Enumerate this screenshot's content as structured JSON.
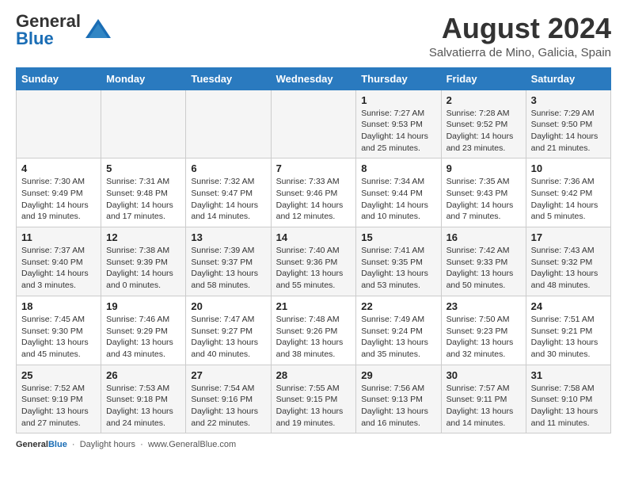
{
  "header": {
    "logo_line1": "General",
    "logo_line2": "Blue",
    "main_title": "August 2024",
    "subtitle": "Salvatierra de Mino, Galicia, Spain"
  },
  "footer": {
    "daylight_label": "Daylight hours",
    "footer_url": "www.GeneralBlue.com"
  },
  "days_of_week": [
    "Sunday",
    "Monday",
    "Tuesday",
    "Wednesday",
    "Thursday",
    "Friday",
    "Saturday"
  ],
  "weeks": [
    [
      {
        "day": "",
        "detail": ""
      },
      {
        "day": "",
        "detail": ""
      },
      {
        "day": "",
        "detail": ""
      },
      {
        "day": "",
        "detail": ""
      },
      {
        "day": "1",
        "detail": "Sunrise: 7:27 AM\nSunset: 9:53 PM\nDaylight: 14 hours and 25 minutes."
      },
      {
        "day": "2",
        "detail": "Sunrise: 7:28 AM\nSunset: 9:52 PM\nDaylight: 14 hours and 23 minutes."
      },
      {
        "day": "3",
        "detail": "Sunrise: 7:29 AM\nSunset: 9:50 PM\nDaylight: 14 hours and 21 minutes."
      }
    ],
    [
      {
        "day": "4",
        "detail": "Sunrise: 7:30 AM\nSunset: 9:49 PM\nDaylight: 14 hours and 19 minutes."
      },
      {
        "day": "5",
        "detail": "Sunrise: 7:31 AM\nSunset: 9:48 PM\nDaylight: 14 hours and 17 minutes."
      },
      {
        "day": "6",
        "detail": "Sunrise: 7:32 AM\nSunset: 9:47 PM\nDaylight: 14 hours and 14 minutes."
      },
      {
        "day": "7",
        "detail": "Sunrise: 7:33 AM\nSunset: 9:46 PM\nDaylight: 14 hours and 12 minutes."
      },
      {
        "day": "8",
        "detail": "Sunrise: 7:34 AM\nSunset: 9:44 PM\nDaylight: 14 hours and 10 minutes."
      },
      {
        "day": "9",
        "detail": "Sunrise: 7:35 AM\nSunset: 9:43 PM\nDaylight: 14 hours and 7 minutes."
      },
      {
        "day": "10",
        "detail": "Sunrise: 7:36 AM\nSunset: 9:42 PM\nDaylight: 14 hours and 5 minutes."
      }
    ],
    [
      {
        "day": "11",
        "detail": "Sunrise: 7:37 AM\nSunset: 9:40 PM\nDaylight: 14 hours and 3 minutes."
      },
      {
        "day": "12",
        "detail": "Sunrise: 7:38 AM\nSunset: 9:39 PM\nDaylight: 14 hours and 0 minutes."
      },
      {
        "day": "13",
        "detail": "Sunrise: 7:39 AM\nSunset: 9:37 PM\nDaylight: 13 hours and 58 minutes."
      },
      {
        "day": "14",
        "detail": "Sunrise: 7:40 AM\nSunset: 9:36 PM\nDaylight: 13 hours and 55 minutes."
      },
      {
        "day": "15",
        "detail": "Sunrise: 7:41 AM\nSunset: 9:35 PM\nDaylight: 13 hours and 53 minutes."
      },
      {
        "day": "16",
        "detail": "Sunrise: 7:42 AM\nSunset: 9:33 PM\nDaylight: 13 hours and 50 minutes."
      },
      {
        "day": "17",
        "detail": "Sunrise: 7:43 AM\nSunset: 9:32 PM\nDaylight: 13 hours and 48 minutes."
      }
    ],
    [
      {
        "day": "18",
        "detail": "Sunrise: 7:45 AM\nSunset: 9:30 PM\nDaylight: 13 hours and 45 minutes."
      },
      {
        "day": "19",
        "detail": "Sunrise: 7:46 AM\nSunset: 9:29 PM\nDaylight: 13 hours and 43 minutes."
      },
      {
        "day": "20",
        "detail": "Sunrise: 7:47 AM\nSunset: 9:27 PM\nDaylight: 13 hours and 40 minutes."
      },
      {
        "day": "21",
        "detail": "Sunrise: 7:48 AM\nSunset: 9:26 PM\nDaylight: 13 hours and 38 minutes."
      },
      {
        "day": "22",
        "detail": "Sunrise: 7:49 AM\nSunset: 9:24 PM\nDaylight: 13 hours and 35 minutes."
      },
      {
        "day": "23",
        "detail": "Sunrise: 7:50 AM\nSunset: 9:23 PM\nDaylight: 13 hours and 32 minutes."
      },
      {
        "day": "24",
        "detail": "Sunrise: 7:51 AM\nSunset: 9:21 PM\nDaylight: 13 hours and 30 minutes."
      }
    ],
    [
      {
        "day": "25",
        "detail": "Sunrise: 7:52 AM\nSunset: 9:19 PM\nDaylight: 13 hours and 27 minutes."
      },
      {
        "day": "26",
        "detail": "Sunrise: 7:53 AM\nSunset: 9:18 PM\nDaylight: 13 hours and 24 minutes."
      },
      {
        "day": "27",
        "detail": "Sunrise: 7:54 AM\nSunset: 9:16 PM\nDaylight: 13 hours and 22 minutes."
      },
      {
        "day": "28",
        "detail": "Sunrise: 7:55 AM\nSunset: 9:15 PM\nDaylight: 13 hours and 19 minutes."
      },
      {
        "day": "29",
        "detail": "Sunrise: 7:56 AM\nSunset: 9:13 PM\nDaylight: 13 hours and 16 minutes."
      },
      {
        "day": "30",
        "detail": "Sunrise: 7:57 AM\nSunset: 9:11 PM\nDaylight: 13 hours and 14 minutes."
      },
      {
        "day": "31",
        "detail": "Sunrise: 7:58 AM\nSunset: 9:10 PM\nDaylight: 13 hours and 11 minutes."
      }
    ]
  ]
}
